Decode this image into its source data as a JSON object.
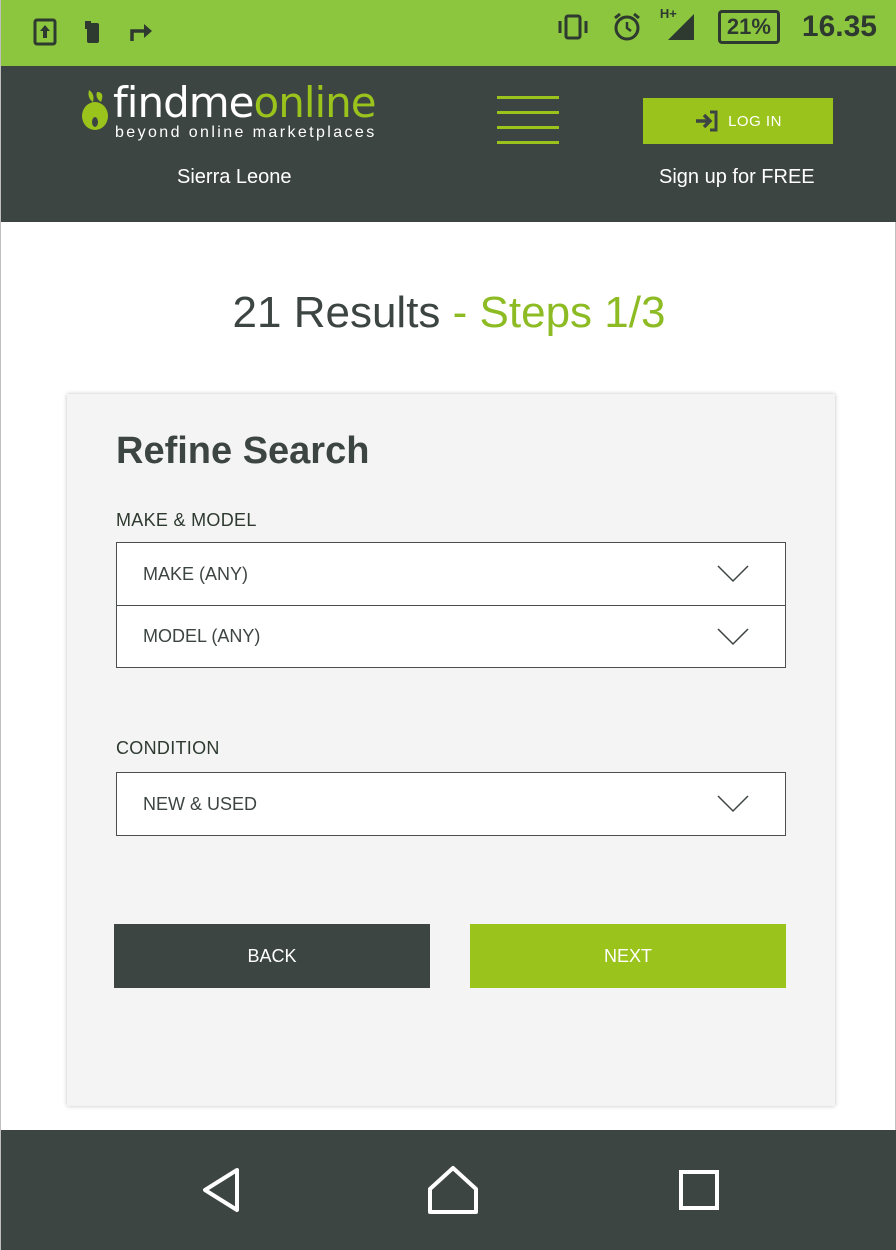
{
  "statusbar": {
    "time": "16.35",
    "battery": "21%",
    "network": "H+",
    "icons": [
      "upload-icon",
      "phone-icon",
      "forward-icon",
      "vibrate-icon",
      "alarm-icon",
      "signal-icon"
    ]
  },
  "header": {
    "logo_text_a": "findme",
    "logo_text_b": "online",
    "logo_tagline": "beyond online marketplaces",
    "login_label": "LOG IN",
    "country": "Sierra Leone",
    "signup": "Sign up for FREE"
  },
  "main": {
    "results": "21 Results",
    "steps": " - Steps 1/3"
  },
  "refine": {
    "title": "Refine Search",
    "make_model_label": "MAKE & MODEL",
    "make": "MAKE (ANY)",
    "model": "MODEL (ANY)",
    "condition_label": "CONDITION",
    "condition": "NEW & USED",
    "back": "BACK",
    "next": "NEXT"
  },
  "colors": {
    "brand_green": "#9ac31c",
    "status_green": "#8cc63f",
    "dark": "#3d4543"
  }
}
